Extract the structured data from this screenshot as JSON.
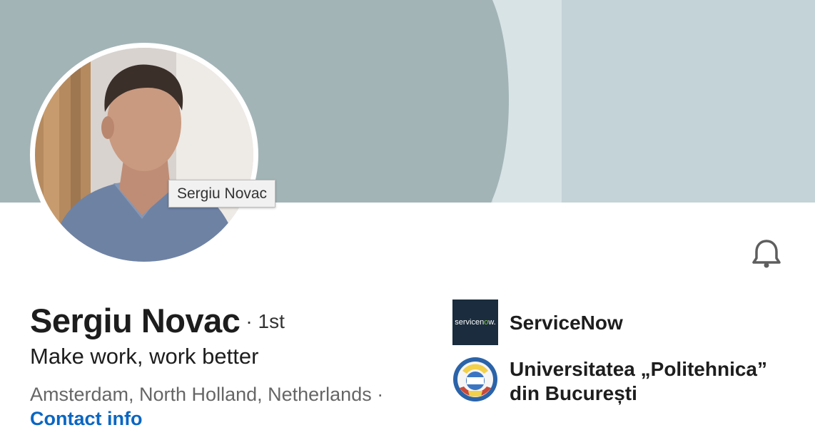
{
  "profile": {
    "name": "Sergiu Novac",
    "degree": "· 1st",
    "headline": "Make work, work better",
    "location": "Amsterdam, North Holland, Netherlands ·",
    "contact_link": "Contact info",
    "tooltip": "Sergiu Novac"
  },
  "organizations": [
    {
      "name": "ServiceNow",
      "logo_text_main": "servicen",
      "logo_text_accent": "o",
      "logo_text_end": "w.",
      "logo_icon": "servicenow-logo"
    },
    {
      "name": "Universitatea „Politehnica” din București",
      "logo_icon": "politehnica-seal-logo"
    }
  ],
  "icons": {
    "notifications": "bell-icon"
  },
  "colors": {
    "cover_dark": "#a3b4b7",
    "cover_light": "#c3d3d7",
    "cover_mid": "#d8e3e6",
    "link": "#0a66c2",
    "servicenow_bg": "#1a2c3d",
    "servicenow_accent": "#7ac143"
  }
}
